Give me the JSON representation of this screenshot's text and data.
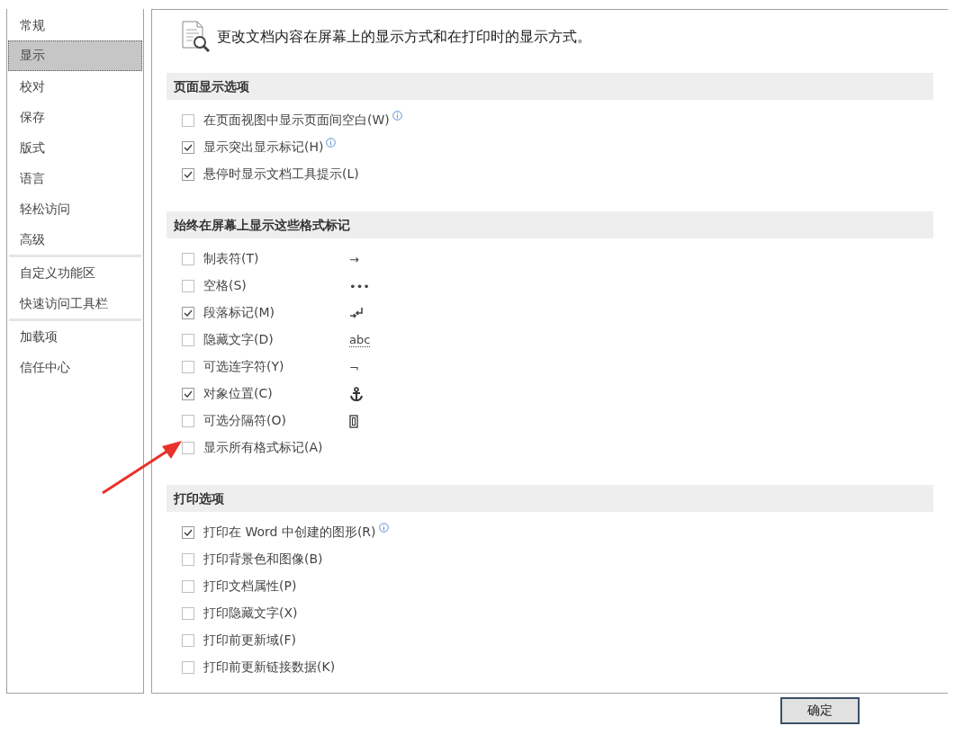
{
  "sidebar": {
    "groups": [
      {
        "items": [
          {
            "label": "常规",
            "selected": false
          },
          {
            "label": "显示",
            "selected": true
          },
          {
            "label": "校对",
            "selected": false
          },
          {
            "label": "保存",
            "selected": false
          },
          {
            "label": "版式",
            "selected": false
          },
          {
            "label": "语言",
            "selected": false
          },
          {
            "label": "轻松访问",
            "selected": false
          },
          {
            "label": "高级",
            "selected": false
          }
        ]
      },
      {
        "items": [
          {
            "label": "自定义功能区",
            "selected": false
          },
          {
            "label": "快速访问工具栏",
            "selected": false
          }
        ]
      },
      {
        "items": [
          {
            "label": "加载项",
            "selected": false
          },
          {
            "label": "信任中心",
            "selected": false
          }
        ]
      }
    ]
  },
  "header": "更改文档内容在屏幕上的显示方式和在打印时的显示方式。",
  "sections": [
    {
      "title": "页面显示选项",
      "options": [
        {
          "label": "在页面视图中显示页面间空白(W)",
          "checked": false,
          "info": true
        },
        {
          "label": "显示突出显示标记(H)",
          "checked": true,
          "info": true
        },
        {
          "label": "悬停时显示文档工具提示(L)",
          "checked": true,
          "info": false
        }
      ]
    },
    {
      "title": "始终在屏幕上显示这些格式标记",
      "options": [
        {
          "label": "制表符(T)",
          "checked": false,
          "info": false,
          "mark": {
            "kind": "text",
            "text": "→"
          }
        },
        {
          "label": "空格(S)",
          "checked": false,
          "info": false,
          "mark": {
            "kind": "text",
            "text": "•••"
          }
        },
        {
          "label": "段落标记(M)",
          "checked": true,
          "info": false,
          "mark": {
            "kind": "paragraph"
          }
        },
        {
          "label": "隐藏文字(D)",
          "checked": false,
          "info": false,
          "mark": {
            "kind": "dotted",
            "text": "abc"
          }
        },
        {
          "label": "可选连字符(Y)",
          "checked": false,
          "info": false,
          "mark": {
            "kind": "text",
            "text": "¬"
          }
        },
        {
          "label": "对象位置(C)",
          "checked": true,
          "info": false,
          "mark": {
            "kind": "anchor"
          }
        },
        {
          "label": "可选分隔符(O)",
          "checked": false,
          "info": false,
          "mark": {
            "kind": "break"
          }
        },
        {
          "label": "显示所有格式标记(A)",
          "checked": false,
          "info": false
        }
      ]
    },
    {
      "title": "打印选项",
      "options": [
        {
          "label": "打印在 Word 中创建的图形(R)",
          "checked": true,
          "info": true
        },
        {
          "label": "打印背景色和图像(B)",
          "checked": false,
          "info": false
        },
        {
          "label": "打印文档属性(P)",
          "checked": false,
          "info": false
        },
        {
          "label": "打印隐藏文字(X)",
          "checked": false,
          "info": false
        },
        {
          "label": "打印前更新域(F)",
          "checked": false,
          "info": false
        },
        {
          "label": "打印前更新链接数据(K)",
          "checked": false,
          "info": false
        }
      ]
    }
  ],
  "buttons": [
    "确定"
  ]
}
